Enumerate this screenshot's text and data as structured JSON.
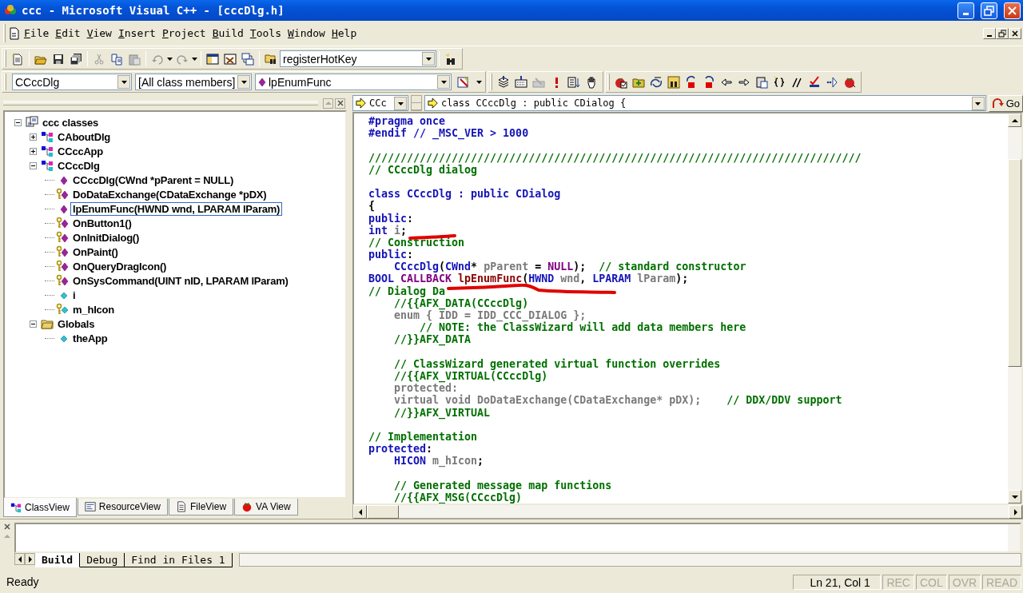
{
  "window": {
    "title": "ccc - Microsoft Visual C++ - [cccDlg.h]"
  },
  "menu": [
    "File",
    "Edit",
    "View",
    "Insert",
    "Project",
    "Build",
    "Tools",
    "Window",
    "Help"
  ],
  "toolbar": {
    "find_combo": "registerHotKey"
  },
  "wizard_bar": {
    "class": "CCccDlg",
    "filter": "[All class members]",
    "member": "lpEnumFunc"
  },
  "class_view": {
    "tree": [
      {
        "label": "ccc classes",
        "kind": "root",
        "expanded": true,
        "selected": false,
        "children": [
          {
            "label": "CAboutDlg",
            "kind": "class",
            "expanded": false,
            "selected": false
          },
          {
            "label": "CCccApp",
            "kind": "class",
            "expanded": false,
            "selected": false
          },
          {
            "label": "CCccDlg",
            "kind": "class",
            "expanded": true,
            "selected": false,
            "children": [
              {
                "label": "CCccDlg(CWnd *pParent = NULL)",
                "kind": "method",
                "selected": false
              },
              {
                "label": "DoDataExchange(CDataExchange *pDX)",
                "kind": "protected_method",
                "selected": false
              },
              {
                "label": "lpEnumFunc(HWND wnd, LPARAM lParam)",
                "kind": "method",
                "selected": true
              },
              {
                "label": "OnButton1()",
                "kind": "protected_method",
                "selected": false
              },
              {
                "label": "OnInitDialog()",
                "kind": "protected_method",
                "selected": false
              },
              {
                "label": "OnPaint()",
                "kind": "protected_method",
                "selected": false
              },
              {
                "label": "OnQueryDragIcon()",
                "kind": "protected_method",
                "selected": false
              },
              {
                "label": "OnSysCommand(UINT nID, LPARAM lParam)",
                "kind": "protected_method",
                "selected": false
              },
              {
                "label": "i",
                "kind": "member",
                "selected": false
              },
              {
                "label": "m_hIcon",
                "kind": "protected_member",
                "selected": false
              }
            ]
          },
          {
            "label": "Globals",
            "kind": "folder",
            "expanded": true,
            "selected": false,
            "children": [
              {
                "label": "theApp",
                "kind": "member",
                "selected": false
              }
            ]
          }
        ]
      }
    ]
  },
  "workspace_tabs": [
    {
      "label": "ClassView",
      "kind": "classes",
      "selected": true
    },
    {
      "label": "ResourceView",
      "kind": "resources",
      "selected": false
    },
    {
      "label": "FileView",
      "kind": "files",
      "selected": false
    },
    {
      "label": "VA View",
      "kind": "tomato",
      "selected": false
    }
  ],
  "navigation_bar": {
    "scope": "CCc",
    "definition": "class CCccDlg : public CDialog {",
    "go_button": "Go"
  },
  "editor": {
    "lines": [
      {
        "kind": "code",
        "tokens": [
          {
            "text": "#pragma once",
            "kind": "keyword"
          }
        ]
      },
      {
        "kind": "code",
        "tokens": [
          {
            "text": "#endif // _MSC_VER > 1000",
            "kind": "keyword"
          }
        ]
      },
      {
        "kind": "blank"
      },
      {
        "kind": "code",
        "tokens": [
          {
            "text": "/////////////////////////////////////////////////////////////////////////////",
            "kind": "comment"
          }
        ]
      },
      {
        "kind": "code",
        "tokens": [
          {
            "text": "// CCccDlg dialog",
            "kind": "comment"
          }
        ]
      },
      {
        "kind": "blank"
      },
      {
        "kind": "code",
        "tokens": [
          {
            "text": "class CCccDlg : public CDialog",
            "kind": "keyword"
          }
        ]
      },
      {
        "kind": "code",
        "tokens": [
          {
            "text": "{",
            "kind": "punct"
          }
        ]
      },
      {
        "kind": "code",
        "tokens": [
          {
            "text": "public",
            "kind": "keyword"
          },
          {
            "text": ":",
            "kind": "punct"
          }
        ]
      },
      {
        "kind": "code",
        "red_mark": true,
        "tokens": [
          {
            "text": "int",
            "kind": "keyword"
          },
          {
            "text": " i",
            "kind": "identifier"
          },
          {
            "text": ";",
            "kind": "punct"
          }
        ]
      },
      {
        "kind": "code",
        "tokens": [
          {
            "text": "// Construction",
            "kind": "comment"
          }
        ]
      },
      {
        "kind": "code",
        "tokens": [
          {
            "text": "public",
            "kind": "keyword"
          },
          {
            "text": ":",
            "kind": "punct"
          }
        ]
      },
      {
        "kind": "code",
        "tokens": [
          {
            "text": "    CCccDlg",
            "kind": "keyword"
          },
          {
            "text": "(",
            "kind": "punct"
          },
          {
            "text": "CWnd",
            "kind": "keyword"
          },
          {
            "text": "* ",
            "kind": "punct"
          },
          {
            "text": "pParent",
            "kind": "identifier"
          },
          {
            "text": " = ",
            "kind": "punct"
          },
          {
            "text": "NULL",
            "kind": "macro"
          },
          {
            "text": ");  ",
            "kind": "punct"
          },
          {
            "text": "// standard constructor",
            "kind": "comment"
          }
        ]
      },
      {
        "kind": "code",
        "red_mark": true,
        "tokens": [
          {
            "text": "BOOL ",
            "kind": "keyword"
          },
          {
            "text": "CALLBACK ",
            "kind": "macro"
          },
          {
            "text": "lpEnumFunc",
            "kind": "function"
          },
          {
            "text": "(",
            "kind": "punct"
          },
          {
            "text": "HWND",
            "kind": "keyword"
          },
          {
            "text": " wnd",
            "kind": "identifier"
          },
          {
            "text": ", ",
            "kind": "punct"
          },
          {
            "text": "LPARAM",
            "kind": "keyword"
          },
          {
            "text": " lParam",
            "kind": "identifier"
          },
          {
            "text": ");",
            "kind": "punct"
          }
        ]
      },
      {
        "kind": "code",
        "tokens": [
          {
            "text": "// Dialog Da",
            "kind": "comment"
          }
        ]
      },
      {
        "kind": "code",
        "tokens": [
          {
            "text": "    //{{AFX_DATA(CCccDlg)",
            "kind": "comment"
          }
        ]
      },
      {
        "kind": "code",
        "tokens": [
          {
            "text": "    enum { IDD = IDD_CCC_DIALOG };",
            "kind": "identifier"
          }
        ]
      },
      {
        "kind": "code",
        "tokens": [
          {
            "text": "        // NOTE: the ClassWizard will add data members here",
            "kind": "comment"
          }
        ]
      },
      {
        "kind": "code",
        "tokens": [
          {
            "text": "    //}}AFX_DATA",
            "kind": "comment"
          }
        ]
      },
      {
        "kind": "blank"
      },
      {
        "kind": "code",
        "tokens": [
          {
            "text": "    // ClassWizard generated virtual function overrides",
            "kind": "comment"
          }
        ]
      },
      {
        "kind": "code",
        "tokens": [
          {
            "text": "    //{{AFX_VIRTUAL(CCccDlg)",
            "kind": "comment"
          }
        ]
      },
      {
        "kind": "code",
        "tokens": [
          {
            "text": "    protected:",
            "kind": "identifier"
          }
        ]
      },
      {
        "kind": "code",
        "tokens": [
          {
            "text": "    virtual void DoDataExchange(CDataExchange* pDX);    ",
            "kind": "identifier"
          },
          {
            "text": "// DDX/DDV support",
            "kind": "comment"
          }
        ]
      },
      {
        "kind": "code",
        "tokens": [
          {
            "text": "    //}}AFX_VIRTUAL",
            "kind": "comment"
          }
        ]
      },
      {
        "kind": "blank"
      },
      {
        "kind": "code",
        "tokens": [
          {
            "text": "// Implementation",
            "kind": "comment"
          }
        ]
      },
      {
        "kind": "code",
        "tokens": [
          {
            "text": "protected",
            "kind": "keyword"
          },
          {
            "text": ":",
            "kind": "punct"
          }
        ]
      },
      {
        "kind": "code",
        "tokens": [
          {
            "text": "    HICON",
            "kind": "keyword"
          },
          {
            "text": " m_hIcon",
            "kind": "identifier"
          },
          {
            "text": ";",
            "kind": "punct"
          }
        ]
      },
      {
        "kind": "blank"
      },
      {
        "kind": "code",
        "tokens": [
          {
            "text": "    // Generated message map functions",
            "kind": "comment"
          }
        ]
      },
      {
        "kind": "code",
        "tokens": [
          {
            "text": "    //{{AFX_MSG(CCccDlg)",
            "kind": "comment"
          }
        ]
      }
    ]
  },
  "output": {
    "tabs": [
      {
        "label": "Build",
        "selected": true
      },
      {
        "label": "Debug",
        "selected": false
      },
      {
        "label": "Find in Files 1",
        "selected": false
      }
    ]
  },
  "status_bar": {
    "message": "Ready",
    "position": "Ln 21, Col 1",
    "indicators": [
      {
        "label": "REC",
        "enabled": false
      },
      {
        "label": "COL",
        "enabled": false
      },
      {
        "label": "OVR",
        "enabled": false
      },
      {
        "label": "READ",
        "enabled": false
      }
    ]
  }
}
